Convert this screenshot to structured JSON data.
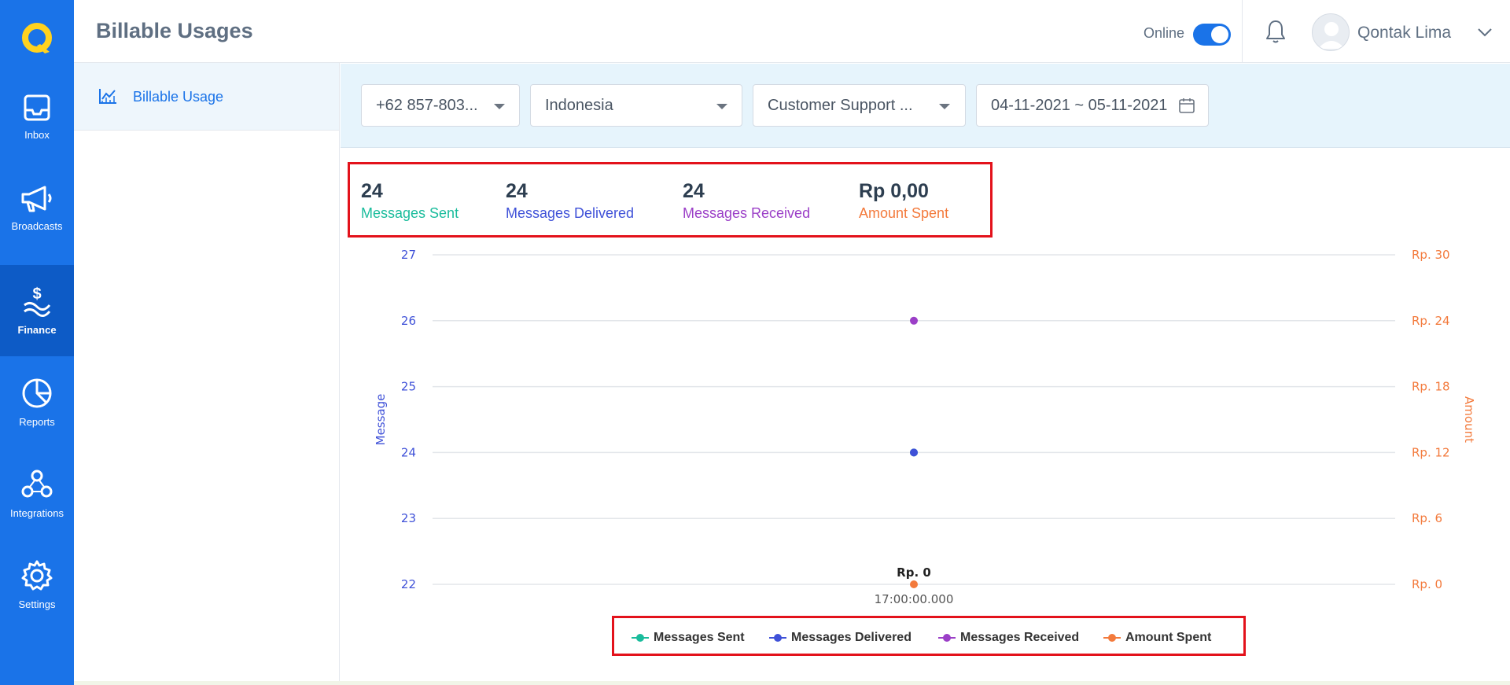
{
  "nav": {
    "items": [
      {
        "label": "Inbox",
        "icon": "inbox-icon"
      },
      {
        "label": "Broadcasts",
        "icon": "megaphone-icon"
      },
      {
        "label": "Finance",
        "icon": "finance-icon",
        "active": true
      },
      {
        "label": "Reports",
        "icon": "pie-chart-icon"
      },
      {
        "label": "Integrations",
        "icon": "integrations-icon"
      },
      {
        "label": "Settings",
        "icon": "gear-icon"
      }
    ]
  },
  "header": {
    "title": "Billable Usages",
    "status_label": "Online",
    "user_name": "Qontak Lima"
  },
  "sidebar": {
    "item_label": "Billable Usage"
  },
  "filters": {
    "phone": "+62 857-803...",
    "country": "Indonesia",
    "channel": "Customer Support ...",
    "date_range": "04-11-2021 ~ 05-11-2021"
  },
  "stats": [
    {
      "value": "24",
      "label": "Messages Sent",
      "color": "#1abc9c"
    },
    {
      "value": "24",
      "label": "Messages Delivered",
      "color": "#3f51d8"
    },
    {
      "value": "24",
      "label": "Messages Received",
      "color": "#9b3fc7"
    },
    {
      "value": "Rp 0,00",
      "label": "Amount Spent",
      "color": "#f37a3c"
    }
  ],
  "chart_data": {
    "type": "scatter",
    "x": [
      "17:00:00.000"
    ],
    "series": [
      {
        "name": "Messages Sent",
        "values": [
          24
        ],
        "color": "#1abc9c",
        "axis": "left"
      },
      {
        "name": "Messages Delivered",
        "values": [
          24
        ],
        "color": "#3f51d8",
        "axis": "left"
      },
      {
        "name": "Messages Received",
        "values": [
          26
        ],
        "color": "#9b3fc7",
        "axis": "left"
      },
      {
        "name": "Amount Spent",
        "values": [
          0
        ],
        "color": "#f37a3c",
        "axis": "right"
      }
    ],
    "ylabel": "Message",
    "ylabel_right": "Amount",
    "ylim": [
      22,
      27
    ],
    "y_ticks": [
      "22",
      "23",
      "24",
      "25",
      "26",
      "27"
    ],
    "ylim_right": [
      0,
      30
    ],
    "y_right_ticks": [
      "Rp. 0",
      "Rp. 6",
      "Rp. 12",
      "Rp. 18",
      "Rp. 24",
      "Rp. 30"
    ],
    "annotations": [
      "Rp. 0"
    ],
    "grid": true,
    "legend_position": "bottom-center"
  }
}
